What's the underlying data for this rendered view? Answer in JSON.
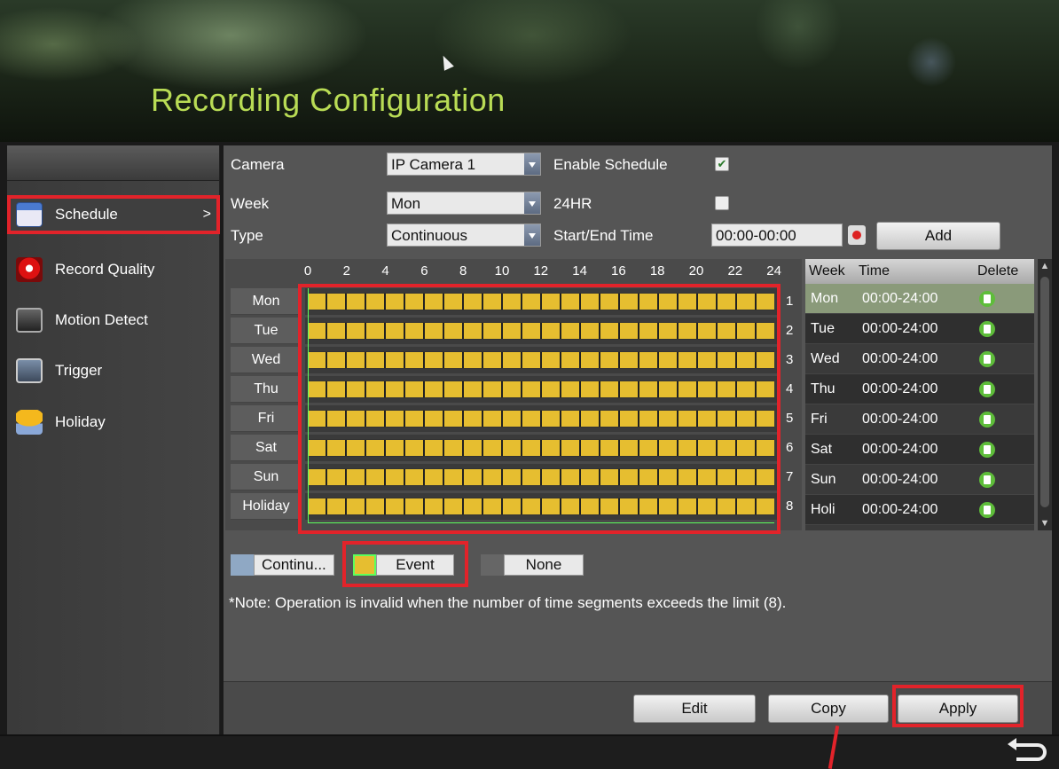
{
  "header": {
    "title": "Recording Configuration"
  },
  "sidebar": {
    "items": [
      {
        "label": "Schedule",
        "icon": "calendar-icon",
        "selected": true
      },
      {
        "label": "Record Quality",
        "icon": "record-icon"
      },
      {
        "label": "Motion Detect",
        "icon": "motion-icon"
      },
      {
        "label": "Trigger",
        "icon": "trigger-icon"
      },
      {
        "label": "Holiday",
        "icon": "holiday-umbrella-icon"
      }
    ],
    "chevron": ">"
  },
  "form": {
    "camera_label": "Camera",
    "camera_value": "IP Camera 1",
    "enable_schedule_label": "Enable Schedule",
    "enable_schedule_checked": true,
    "check_mark": "✔",
    "week_label": "Week",
    "week_value": "Mon",
    "hr24_label": "24HR",
    "hr24_checked": false,
    "type_label": "Type",
    "type_value": "Continuous",
    "start_end_label": "Start/End Time",
    "start_end_value": "00:00-00:00",
    "add_button": "Add"
  },
  "grid": {
    "hours": [
      "0",
      "2",
      "4",
      "6",
      "8",
      "10",
      "12",
      "14",
      "16",
      "18",
      "20",
      "22",
      "24"
    ],
    "days": [
      "Mon",
      "Tue",
      "Wed",
      "Thu",
      "Fri",
      "Sat",
      "Sun",
      "Holiday"
    ],
    "row_numbers": [
      "1",
      "2",
      "3",
      "4",
      "5",
      "6",
      "7",
      "8"
    ]
  },
  "list": {
    "headers": {
      "week": "Week",
      "time": "Time",
      "delete": "Delete"
    },
    "rows": [
      {
        "day": "Mon",
        "time": "00:00-24:00"
      },
      {
        "day": "Tue",
        "time": "00:00-24:00"
      },
      {
        "day": "Wed",
        "time": "00:00-24:00"
      },
      {
        "day": "Thu",
        "time": "00:00-24:00"
      },
      {
        "day": "Fri",
        "time": "00:00-24:00"
      },
      {
        "day": "Sat",
        "time": "00:00-24:00"
      },
      {
        "day": "Sun",
        "time": "00:00-24:00"
      },
      {
        "day": "Holi",
        "time": "00:00-24:00"
      }
    ]
  },
  "legend": {
    "continuous": "Continu...",
    "event": "Event",
    "none": "None",
    "colors": {
      "continuous": "#8fa8c4",
      "event": "#e6be30",
      "none": "#666666"
    }
  },
  "note": "*Note: Operation is invalid when the number of time segments exceeds the limit (8).",
  "buttons": {
    "edit": "Edit",
    "copy": "Copy",
    "apply": "Apply"
  },
  "colors": {
    "accent": "#b9dc55",
    "highlight": "#e2232a",
    "schedule_fill": "#e6be30"
  }
}
